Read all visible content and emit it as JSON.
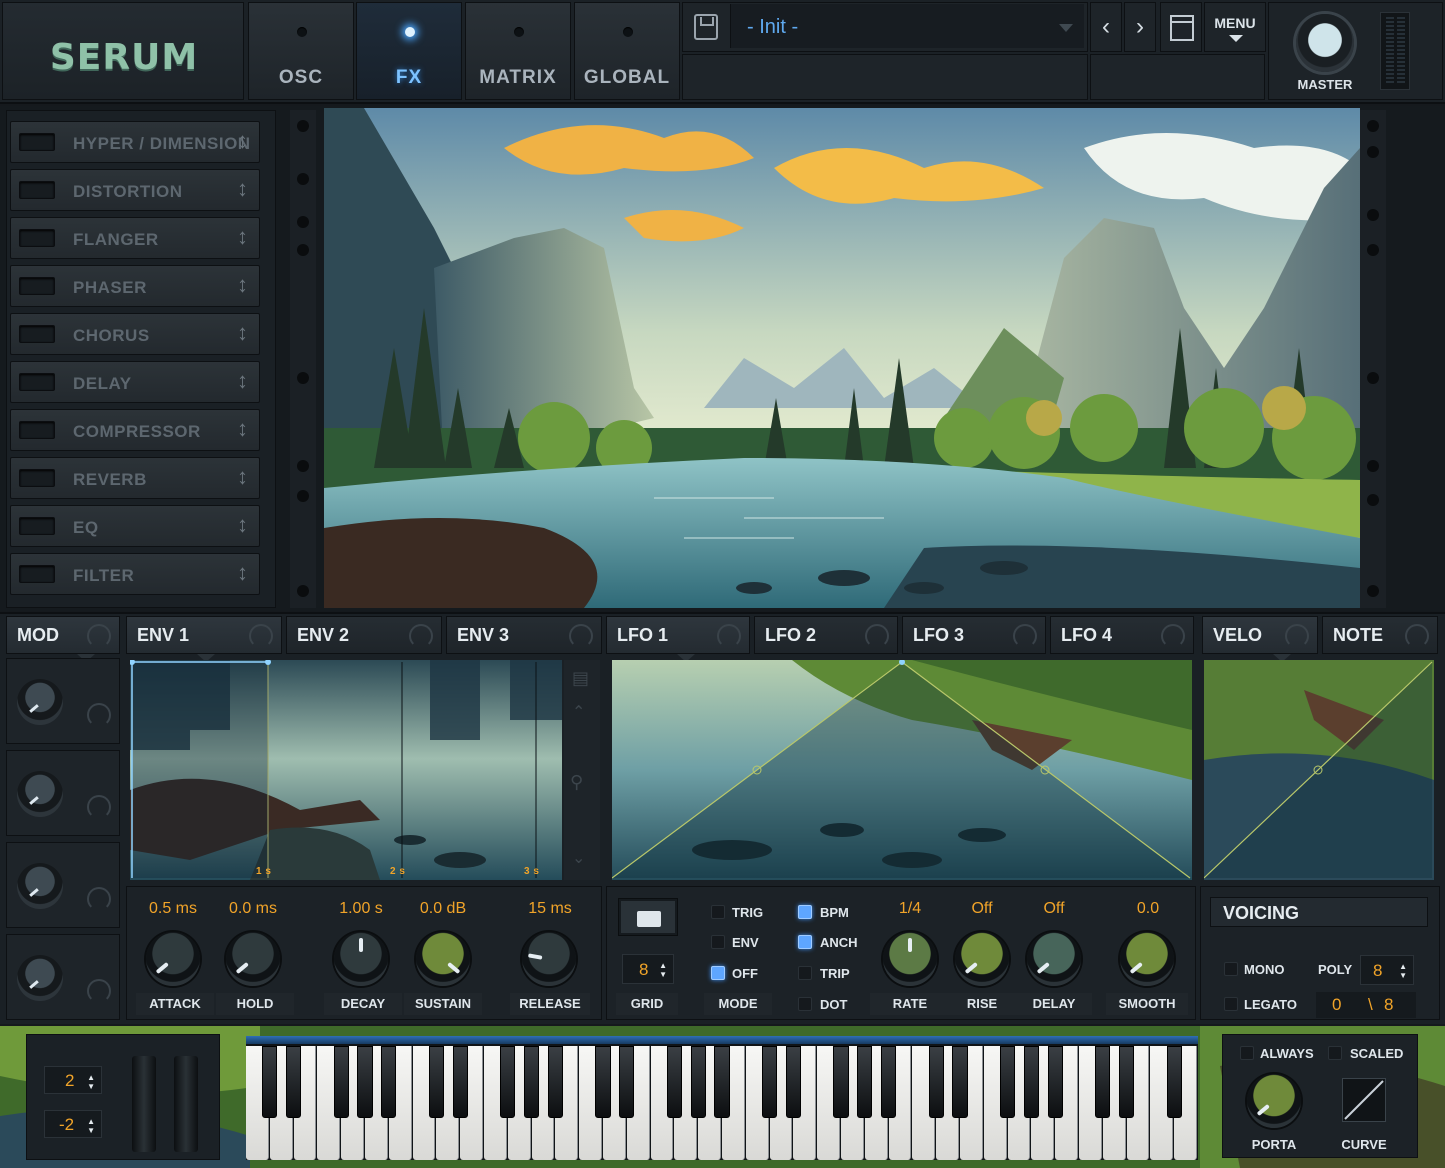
{
  "app": {
    "logo": "SERUM"
  },
  "tabs": [
    {
      "label": "OSC",
      "active": false
    },
    {
      "label": "FX",
      "active": true
    },
    {
      "label": "MATRIX",
      "active": false
    },
    {
      "label": "GLOBAL",
      "active": false
    }
  ],
  "preset": {
    "name": "- Init -",
    "menu_label": "MENU",
    "prev_icon": "chevron-left-icon",
    "next_icon": "chevron-right-icon"
  },
  "master": {
    "label": "MASTER"
  },
  "fx_rack": [
    "HYPER / DIMENSION",
    "DISTORTION",
    "FLANGER",
    "PHASER",
    "CHORUS",
    "DELAY",
    "COMPRESSOR",
    "REVERB",
    "EQ",
    "FILTER"
  ],
  "mod": {
    "label": "MOD"
  },
  "env_tabs": [
    "ENV 1",
    "ENV 2",
    "ENV 3"
  ],
  "lfo_tabs": [
    "LFO 1",
    "LFO 2",
    "LFO 3",
    "LFO 4"
  ],
  "velo_tabs": [
    "VELO",
    "NOTE"
  ],
  "env_markers": [
    "1 s",
    "2 s",
    "3 s"
  ],
  "env_knobs": [
    {
      "label": "ATTACK",
      "value": "0.5 ms"
    },
    {
      "label": "HOLD",
      "value": "0.0 ms"
    },
    {
      "label": "DECAY",
      "value": "1.00 s"
    },
    {
      "label": "SUSTAIN",
      "value": "0.0 dB"
    },
    {
      "label": "RELEASE",
      "value": "15 ms"
    }
  ],
  "lfo_controls": {
    "grid_label": "GRID",
    "grid_value": "8",
    "mode_label": "MODE",
    "checks_col1": [
      {
        "label": "TRIG",
        "on": false
      },
      {
        "label": "ENV",
        "on": false
      },
      {
        "label": "OFF",
        "on": true
      }
    ],
    "checks_col2": [
      {
        "label": "BPM",
        "on": true
      },
      {
        "label": "ANCH",
        "on": true
      },
      {
        "label": "TRIP",
        "on": false
      },
      {
        "label": "DOT",
        "on": false
      }
    ],
    "knobs": [
      {
        "label": "RATE",
        "value": "1/4"
      },
      {
        "label": "RISE",
        "value": "Off"
      },
      {
        "label": "DELAY",
        "value": "Off"
      },
      {
        "label": "SMOOTH",
        "value": "0.0"
      }
    ]
  },
  "voicing": {
    "title": "VOICING",
    "mono_label": "MONO",
    "legato_label": "LEGATO",
    "poly_label": "POLY",
    "poly_value": "8",
    "voices_current": "0",
    "voices_sep": "\\",
    "voices_total": "8"
  },
  "octave": {
    "up": "2",
    "down": "-2"
  },
  "porta": {
    "always_label": "ALWAYS",
    "scaled_label": "SCALED",
    "porta_label": "PORTA",
    "curve_label": "CURVE"
  },
  "colors": {
    "accent_blue": "#5fa9ef",
    "value_orange": "#f1a429",
    "logo_green": "#8fc1a8"
  }
}
